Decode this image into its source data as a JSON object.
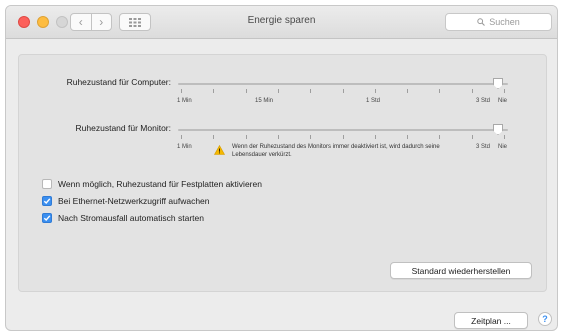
{
  "window": {
    "title": "Energie sparen",
    "search_placeholder": "Suchen",
    "nav_back_glyph": "‹",
    "nav_forward_glyph": "›"
  },
  "computer_sleep": {
    "label": "Ruhezustand für Computer:",
    "tick_labels": [
      "1 Min",
      "15 Min",
      "1 Std",
      "3 Std",
      "Nie"
    ],
    "selected": "Nie"
  },
  "display_sleep": {
    "label": "Ruhezustand für Monitor:",
    "tick_labels": [
      "1 Min",
      "3 Std",
      "Nie"
    ],
    "selected": "Nie",
    "warning": "Wenn der Ruhezustand des Monitors immer deaktiviert ist, wird dadurch seine Lebensdauer verkürzt."
  },
  "options": [
    {
      "label": "Wenn möglich, Ruhezustand für Festplatten aktivieren",
      "checked": false
    },
    {
      "label": "Bei Ethernet-Netzwerkzugriff aufwachen",
      "checked": true
    },
    {
      "label": "Nach Stromausfall automatisch starten",
      "checked": true
    }
  ],
  "buttons": {
    "restore_defaults": "Standard wiederherstellen",
    "schedule": "Zeitplan ...",
    "help": "?"
  },
  "colors": {
    "accent": "#3b8ff0",
    "close": "#fc605b",
    "minimize": "#fdbc40",
    "warning": "#f5b800"
  },
  "icons": {
    "back": "chevron-left-icon",
    "forward": "chevron-right-icon",
    "grid": "grid-icon",
    "search": "search-icon",
    "warning": "warning-icon",
    "checkmark": "checkmark-icon"
  }
}
